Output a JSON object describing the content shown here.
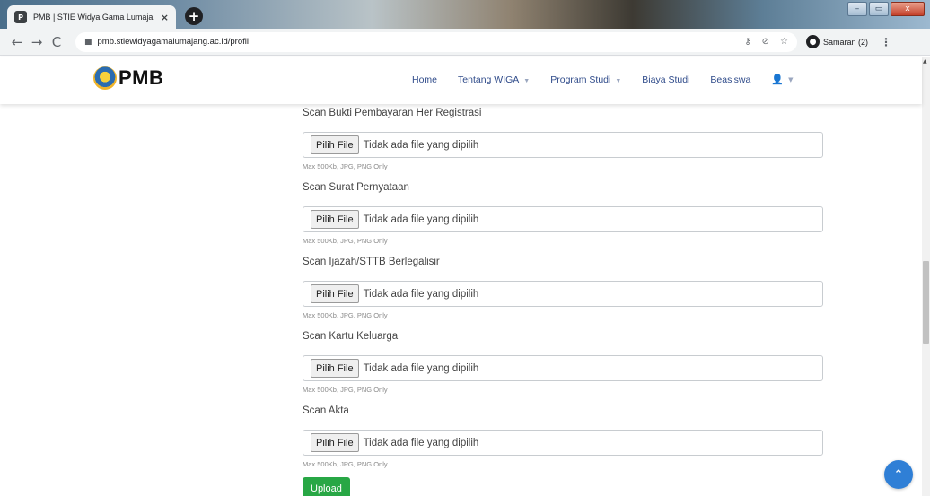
{
  "browser": {
    "tab_title": "PMB | STIE Widya Gama Lumaja",
    "tab_favicon": "P",
    "tab_close": "×",
    "new_tab": "+",
    "url": "pmb.stiewidyagamalumajang.ac.id/profil",
    "profile_label": "Samaran (2)",
    "window_minimize": "–",
    "window_maximize": "▭",
    "window_close": "x",
    "icons": [
      "back-arrow-icon",
      "forward-arrow-icon",
      "reload-icon",
      "lock-icon",
      "key-icon",
      "incognito-icon",
      "star-icon",
      "menu-dots-icon"
    ]
  },
  "site": {
    "brand": "PMB",
    "nav": [
      {
        "label": "Home",
        "has_dropdown": false
      },
      {
        "label": "Tentang WIGA",
        "has_dropdown": true
      },
      {
        "label": "Program Studi",
        "has_dropdown": true
      },
      {
        "label": "Biaya Studi",
        "has_dropdown": false
      },
      {
        "label": "Beasiswa",
        "has_dropdown": false
      }
    ],
    "nav_color": "#2f4b8a"
  },
  "form": {
    "fields": [
      {
        "label": "Scan Bukti Pembayaran Her Registrasi",
        "button": "Pilih File",
        "status": "Tidak ada file yang dipilih",
        "hint": "Max 500Kb, JPG, PNG Only"
      },
      {
        "label": "Scan Surat Pernyataan",
        "button": "Pilih File",
        "status": "Tidak ada file yang dipilih",
        "hint": "Max 500Kb, JPG, PNG Only"
      },
      {
        "label": "Scan Ijazah/STTB Berlegalisir",
        "button": "Pilih File",
        "status": "Tidak ada file yang dipilih",
        "hint": "Max 500Kb, JPG, PNG Only"
      },
      {
        "label": "Scan Kartu Keluarga",
        "button": "Pilih File",
        "status": "Tidak ada file yang dipilih",
        "hint": "Max 500Kb, JPG, PNG Only"
      },
      {
        "label": "Scan Akta",
        "button": "Pilih File",
        "status": "Tidak ada file yang dipilih",
        "hint": "Max 500Kb, JPG, PNG Only"
      }
    ],
    "submit_label": "Upload",
    "submit_color": "#28a745"
  },
  "back_to_top_color": "#2f7fd6"
}
